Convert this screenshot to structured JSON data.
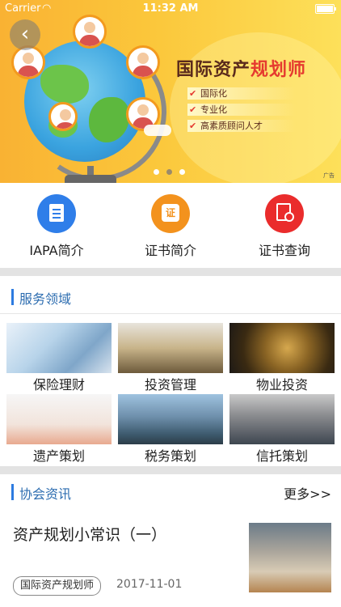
{
  "status_bar": {
    "carrier": "Carrier",
    "time": "11:32 AM"
  },
  "banner": {
    "title_main": "国际资产",
    "title_highlight": "规划师",
    "bullets": [
      "国际化",
      "专业化",
      "高素质顾问人才"
    ],
    "ad_label": "广告",
    "active_slide": 2,
    "slide_count": 3
  },
  "quick_entries": [
    {
      "label": "IAPA简介",
      "icon": "document-icon",
      "color": "#2f7ee9"
    },
    {
      "label": "证书简介",
      "icon": "certificate-icon",
      "color": "#f3921d"
    },
    {
      "label": "证书查询",
      "icon": "search-document-icon",
      "color": "#ea2c2c"
    }
  ],
  "services": {
    "title": "服务领域",
    "items": [
      {
        "label": "保险理财"
      },
      {
        "label": "投资管理"
      },
      {
        "label": "物业投资"
      },
      {
        "label": "遗产策划"
      },
      {
        "label": "税务策划"
      },
      {
        "label": "信托策划"
      }
    ]
  },
  "news_section": {
    "title": "协会资讯",
    "more": "更多>>",
    "articles": [
      {
        "title": "资产规划小常识（一）",
        "tag": "国际资产规划师",
        "date": "2017-11-01"
      }
    ]
  },
  "colors": {
    "accent": "#2d7be0",
    "banner_yellow": "#fbc73b",
    "highlight_red": "#e53a2f"
  }
}
